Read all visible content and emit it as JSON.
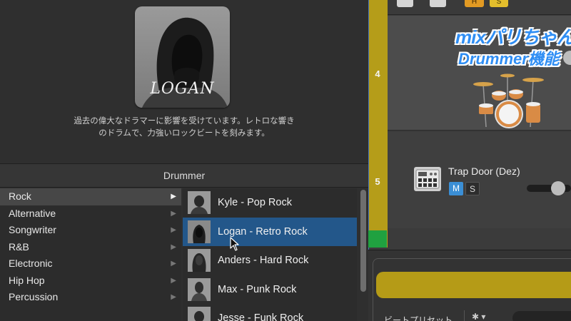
{
  "artist": {
    "signature": "LOGAN",
    "description_line1": "過去の偉大なドラマーに影響を受けています。レトロな響き",
    "description_line2": "のドラムで、力強いロックビートを刻みます。"
  },
  "library": {
    "header": "Drummer",
    "genres": [
      {
        "label": "Rock",
        "selected": true
      },
      {
        "label": "Alternative",
        "selected": false
      },
      {
        "label": "Songwriter",
        "selected": false
      },
      {
        "label": "R&B",
        "selected": false
      },
      {
        "label": "Electronic",
        "selected": false
      },
      {
        "label": "Hip Hop",
        "selected": false
      },
      {
        "label": "Percussion",
        "selected": false
      }
    ],
    "genre_arrow": "▶",
    "drummers": [
      {
        "label": "Kyle - Pop Rock",
        "selected": false
      },
      {
        "label": "Logan - Retro Rock",
        "selected": true
      },
      {
        "label": "Anders - Hard Rock",
        "selected": false
      },
      {
        "label": "Max - Punk Rock",
        "selected": false
      },
      {
        "label": "Jesse - Funk Rock",
        "selected": false
      }
    ]
  },
  "tracks": {
    "top_buttons": {
      "h": "H",
      "s": "S"
    },
    "track4_number": "4",
    "track5_number": "5",
    "track5_name": "Trap Door (Dez)",
    "track5_mute": "M",
    "track5_solo": "S",
    "play_icon": "play-icon"
  },
  "overlay": {
    "logo_line1": "mixパリちゃん",
    "logo_line2": "Drummer機能"
  },
  "editor": {
    "preset_label": "ビートプリセット",
    "gear_label": "✱ ▾"
  },
  "colors": {
    "selection_blue": "#23578a",
    "track_gold": "#b59d19",
    "mute_blue": "#3b8fd6",
    "logo_blue": "#2f8ef4"
  }
}
